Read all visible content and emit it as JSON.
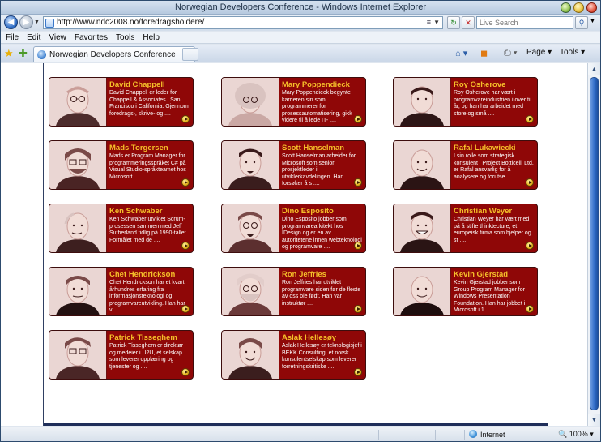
{
  "window": {
    "title": "Norwegian Developers Conference - Windows Internet Explorer"
  },
  "address": {
    "url": "http://www.ndc2008.no/foredragsholdere/"
  },
  "search": {
    "placeholder": "Live Search"
  },
  "menu": [
    "File",
    "Edit",
    "View",
    "Favorites",
    "Tools",
    "Help"
  ],
  "tab": {
    "label": "Norwegian Developers Conference"
  },
  "commandbar": {
    "page_label": "Page",
    "tools_label": "Tools"
  },
  "status": {
    "zone": "Internet",
    "zoom": "100%"
  },
  "speakers": [
    {
      "name": "David Chappell",
      "desc": "David Chappell er leder for Chappell & Associates i San Francisco i California. Gjennom foredrags-, skrive- og ....",
      "face": "bald-glasses"
    },
    {
      "name": "Mary Poppendieck",
      "desc": "Mary Poppendieck begynte karrieren sin som programmerer for prosessautomatisering, gikk videre til å lede IT- ....",
      "face": "grey-curls"
    },
    {
      "name": "Roy Osherove",
      "desc": "Roy Osherove har vært i programvareindustrien i over ti år, og han har arbeidet med store og små ....",
      "face": "short-dark"
    },
    {
      "name": "Mads Torgersen",
      "desc": "Mads er Program Manager for programmeringsspråket C# på Visual Studio-språkteamet hos Microsoft. ....",
      "face": "glasses-beard"
    },
    {
      "name": "Scott Hanselman",
      "desc": "Scott Hanselman arbeider for Microsoft som senior prosjektleder i utviklerkavdelingen. Han forsøker å s ....",
      "face": "dark-goatee"
    },
    {
      "name": "Rafal Lukawiecki",
      "desc": "I sin rolle som strategisk konsulent i Project Botticelli Ltd. er Rafal ansvarlig for å analysere og forutse ....",
      "face": "bald-smile"
    },
    {
      "name": "Ken Schwaber",
      "desc": "Ken Schwaber utviklet Scrum-prosessen sammen med Jeff Sutherland tidlig på 1990-tallet. Formålet med de ....",
      "face": "bald-side"
    },
    {
      "name": "Dino Esposito",
      "desc": "Dino Esposito jobber som programvarearkitekt hos IDesign og er en av autoritetene innen webteknologi og programvare ....",
      "face": "glasses-goatee"
    },
    {
      "name": "Christian Weyer",
      "desc": "Christian Weyer har vært med på å stifte thinktecture, et europeisk firma som hjelper og st ....",
      "face": "dark-grin"
    },
    {
      "name": "Chet Hendrickson",
      "desc": "Chet Hendrickson har et kvart århundres erfaring fra informasjonsteknologi og programvareutvikling. Han har v ....",
      "face": "heavy-suit"
    },
    {
      "name": "Ron Jeffries",
      "desc": "Ron Jeffries har utviklet programvare siden før de fleste av oss ble født. Han var instruktør ....",
      "face": "grey-beard"
    },
    {
      "name": "Kevin Gjerstad",
      "desc": "Kevin Gjerstad jobber som Group Program Manager for Windows Presentation Foundation. Han har jobbet i Microsoft i 1 ....",
      "face": "bald-dark"
    },
    {
      "name": "Patrick Tisseghem",
      "desc": "Patrick Tisseghem er direktør og medeier i U2U, et selskap som leverer opplæring og tjenester og ....",
      "face": "glasses-tilt"
    },
    {
      "name": "Aslak Hellesøy",
      "desc": "Aslak Hellesøy er teknologisjef i BEKK Consulting, et norsk konsulentselskap som leverer forretningskritiske ....",
      "face": "young-smile"
    }
  ]
}
